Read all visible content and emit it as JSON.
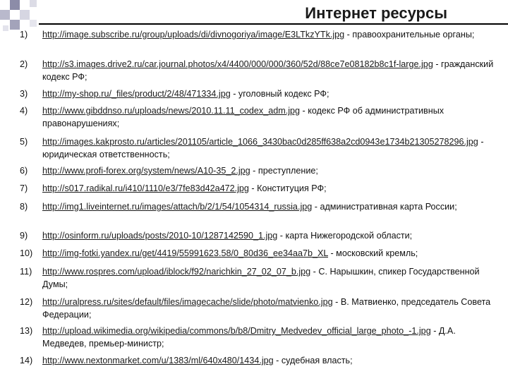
{
  "title": "Интернет ресурсы",
  "items": [
    {
      "num": "1)",
      "url": "http://image.subscribe.ru/group/uploads/di/divnogoriya/image/E3LTkzYTk.jpg",
      "desc": " - правоохранительные органы;"
    },
    {
      "num": "2)",
      "url": "http://s3.images.drive2.ru/car.journal.photos/x4/4400/000/000/360/52d/88ce7e08182b8c1f-large.jpg",
      "desc": " - гражданский кодекс РФ;"
    },
    {
      "num": "3)",
      "url": "http://my-shop.ru/_files/product/2/48/471334.jpg",
      "desc": " - уголовный кодекс РФ;"
    },
    {
      "num": "4)",
      "url": "http://www.gibddnso.ru/uploads/news/2010.11.11_codex_adm.jpg",
      "desc": " - кодекс РФ об административных правонарушениях;"
    },
    {
      "num": "5)",
      "url": "http://images.kakprosto.ru/articles/201105/article_1066_3430bac0d285ff638a2cd0943e1734b21305278296.jpg",
      "desc": " - юридическая ответственность;"
    },
    {
      "num": "6)",
      "url": "http://www.profi-forex.org/system/news/A10-35_2.jpg",
      "desc": " - преступление;"
    },
    {
      "num": "7)",
      "url": "http://s017.radikal.ru/i410/1110/e3/7fe83d42a472.jpg",
      "desc": " - Конституция РФ;"
    },
    {
      "num": "8)",
      "url": "http://img1.liveinternet.ru/images/attach/b/2/1/54/1054314_russia.jpg",
      "desc": " - административная карта России;"
    },
    {
      "num": "9)",
      "url": "http://osinform.ru/uploads/posts/2010-10/1287142590_1.jpg",
      "desc": " - карта Нижегородской области;"
    },
    {
      "num": "10)",
      "url": "http://img-fotki.yandex.ru/get/4419/55991623.58/0_80d36_ee34aa7b_XL",
      "desc": " - московский кремль;"
    },
    {
      "num": "11)",
      "url": "http://www.rospres.com/upload/iblock/f92/narichkin_27_02_07_b.jpg",
      "desc": " - С. Нарышкин, спикер Государственной Думы;"
    },
    {
      "num": "12)",
      "url": "http://uralpress.ru/sites/default/files/imagecache/slide/photo/matvienko.jpg",
      "desc": " - В. Матвиенко, председатель Совета Федерации;"
    },
    {
      "num": "13)",
      "url": "http://upload.wikimedia.org/wikipedia/commons/b/b8/Dmitry_Medvedev_official_large_photo_-1.jpg",
      "desc": " - Д.А. Медведев, премьер-министр;"
    },
    {
      "num": "14)",
      "url": "http://www.nextonmarket.com/u/1383/ml/640x480/1434.jpg",
      "desc": " - судебная власть;"
    }
  ]
}
